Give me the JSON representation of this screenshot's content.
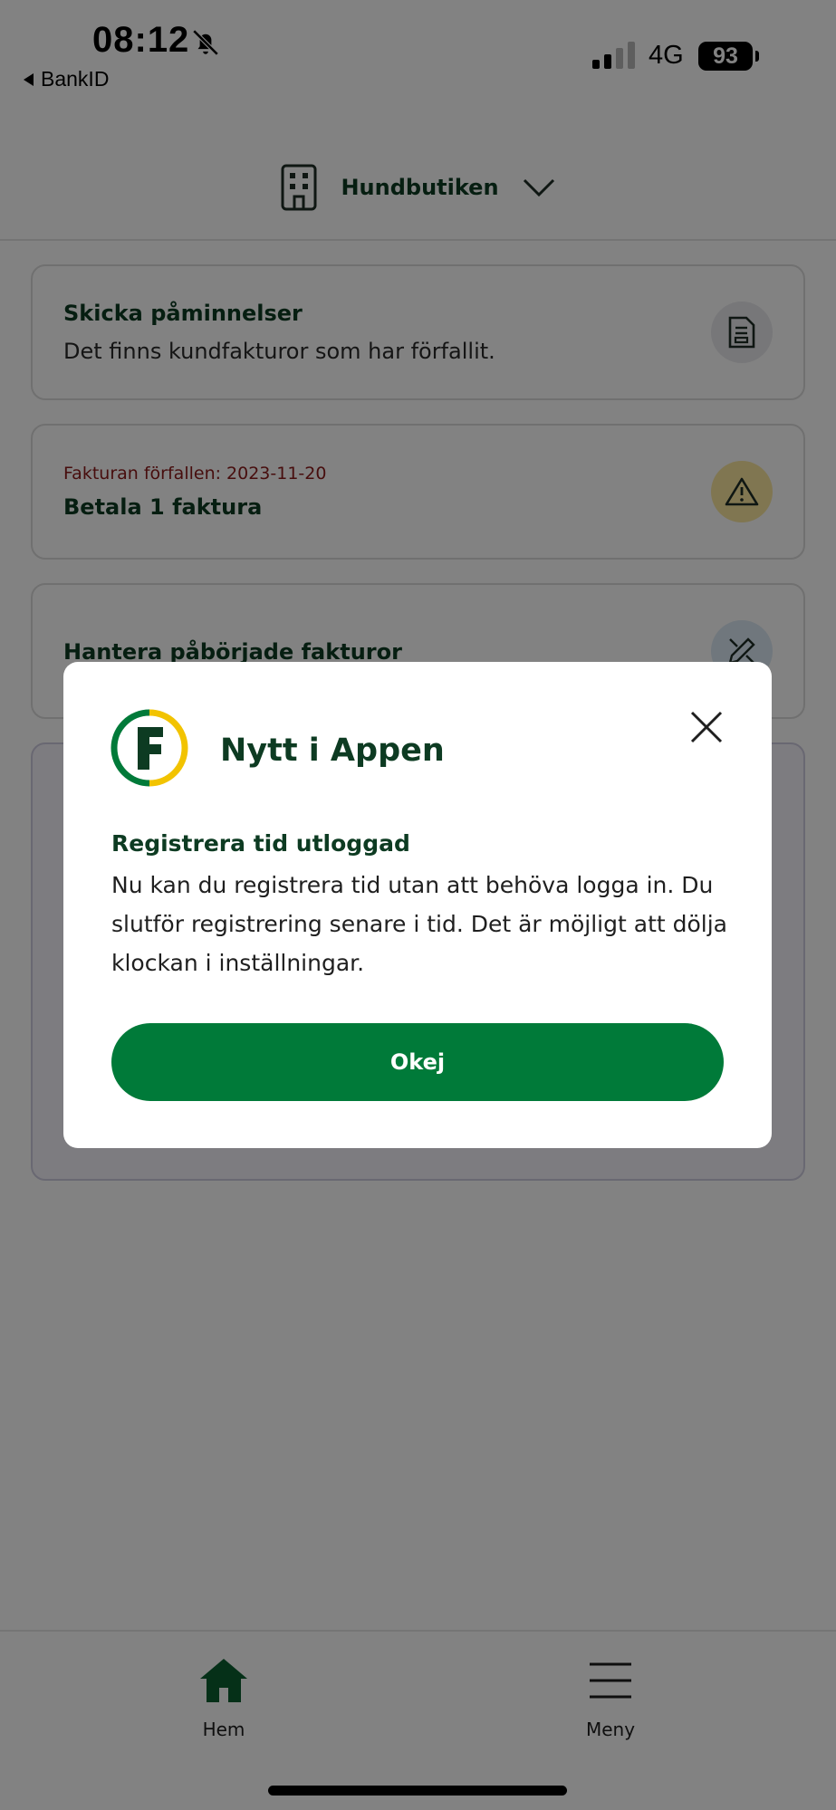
{
  "status_bar": {
    "time": "08:12",
    "back_app": "BankID",
    "network": "4G",
    "battery": "93"
  },
  "header": {
    "company": "Hundbutiken"
  },
  "cards": [
    {
      "title": "Skicka påminnelser",
      "text": "Det finns kundfakturor som har förfallit."
    },
    {
      "meta": "Fakturan förfallen: 2023-11-20",
      "title": "Betala 1 faktura"
    },
    {
      "title": "Hantera påbörjade fakturor"
    }
  ],
  "modal": {
    "title": "Nytt i Appen",
    "heading": "Registrera tid utloggad",
    "body": "Nu kan du registrera tid utan att behöva logga in. Du slutför registrering senare i tid. Det är möjligt att dölja klockan i inställningar.",
    "button": "Okej"
  },
  "nav": {
    "home": "Hem",
    "menu": "Meny"
  },
  "colors": {
    "brand_green": "#007a39",
    "dark_green": "#0d3b22",
    "logo_yellow": "#f2c300",
    "warning_bg": "#fbe7a0",
    "overdue_red": "#8b1a1a"
  },
  "icons": {
    "building": "building-icon",
    "chevron": "chevron-down-icon",
    "document": "document-icon",
    "warning": "warning-icon",
    "edit": "pencil-ruler-icon",
    "close": "close-icon",
    "home": "home-icon",
    "menu": "menu-icon"
  }
}
